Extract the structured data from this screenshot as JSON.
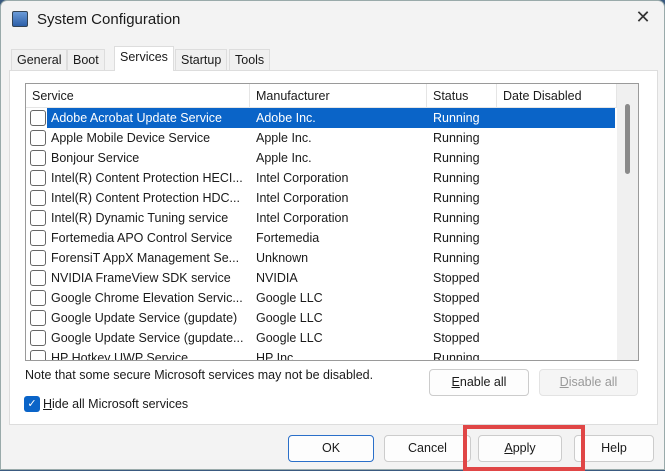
{
  "window": {
    "title": "System Configuration",
    "close": "✕"
  },
  "tabs": [
    "General",
    "Boot",
    "Services",
    "Startup",
    "Tools"
  ],
  "columns": [
    "Service",
    "Manufacturer",
    "Status",
    "Date Disabled"
  ],
  "rows": [
    [
      "Adobe Acrobat Update Service",
      "Adobe Inc.",
      "Running",
      ""
    ],
    [
      "Apple Mobile Device Service",
      "Apple Inc.",
      "Running",
      ""
    ],
    [
      "Bonjour Service",
      "Apple Inc.",
      "Running",
      ""
    ],
    [
      "Intel(R) Content Protection HECI...",
      "Intel Corporation",
      "Running",
      ""
    ],
    [
      "Intel(R) Content Protection HDC...",
      "Intel Corporation",
      "Running",
      ""
    ],
    [
      "Intel(R) Dynamic Tuning service",
      "Intel Corporation",
      "Running",
      ""
    ],
    [
      "Fortemedia APO Control Service",
      "Fortemedia",
      "Running",
      ""
    ],
    [
      "ForensiT AppX Management Se...",
      "Unknown",
      "Running",
      ""
    ],
    [
      "NVIDIA FrameView SDK service",
      "NVIDIA",
      "Stopped",
      ""
    ],
    [
      "Google Chrome Elevation Servic...",
      "Google LLC",
      "Stopped",
      ""
    ],
    [
      "Google Update Service (gupdate)",
      "Google LLC",
      "Stopped",
      ""
    ],
    [
      "Google Update Service (gupdate...",
      "Google LLC",
      "Stopped",
      ""
    ],
    [
      "HP Hotkey UWP Service",
      "HP Inc.",
      "Running",
      ""
    ]
  ],
  "note": "Note that some secure Microsoft services may not be disabled.",
  "enable_all": {
    "u": "E",
    "rest": "nable all"
  },
  "disable_all": {
    "u": "D",
    "rest": "isable all"
  },
  "hide_ms": {
    "u": "H",
    "rest": "ide all Microsoft services",
    "checked": true
  },
  "buttons": {
    "ok": "OK",
    "cancel": "Cancel",
    "apply_u": "A",
    "apply_rest": "pply",
    "help": "Help"
  },
  "colors": {
    "highlight": "#e04646",
    "selection": "#0a64c8"
  }
}
